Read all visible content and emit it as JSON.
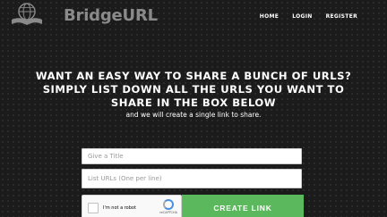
{
  "brand": {
    "name": "BridgeURL"
  },
  "nav": {
    "home": "HOME",
    "login": "LOGIN",
    "register": "REGISTER"
  },
  "hero": {
    "headline": "WANT AN EASY WAY TO SHARE A BUNCH OF URLS? SIMPLY LIST DOWN ALL THE URLS YOU WANT TO SHARE IN THE BOX BELOW",
    "subtext": "and we will create a single link to share."
  },
  "form": {
    "title_placeholder": "Give a Title",
    "urls_placeholder": "List URLs (One per line)",
    "captcha_label": "I'm not a robot",
    "captcha_brand": "reCAPTCHA",
    "submit_label": "CREATE LINK"
  },
  "colors": {
    "button": "#5cb85c",
    "background": "#1b1b1b",
    "logo_text": "#8a8a8a"
  }
}
